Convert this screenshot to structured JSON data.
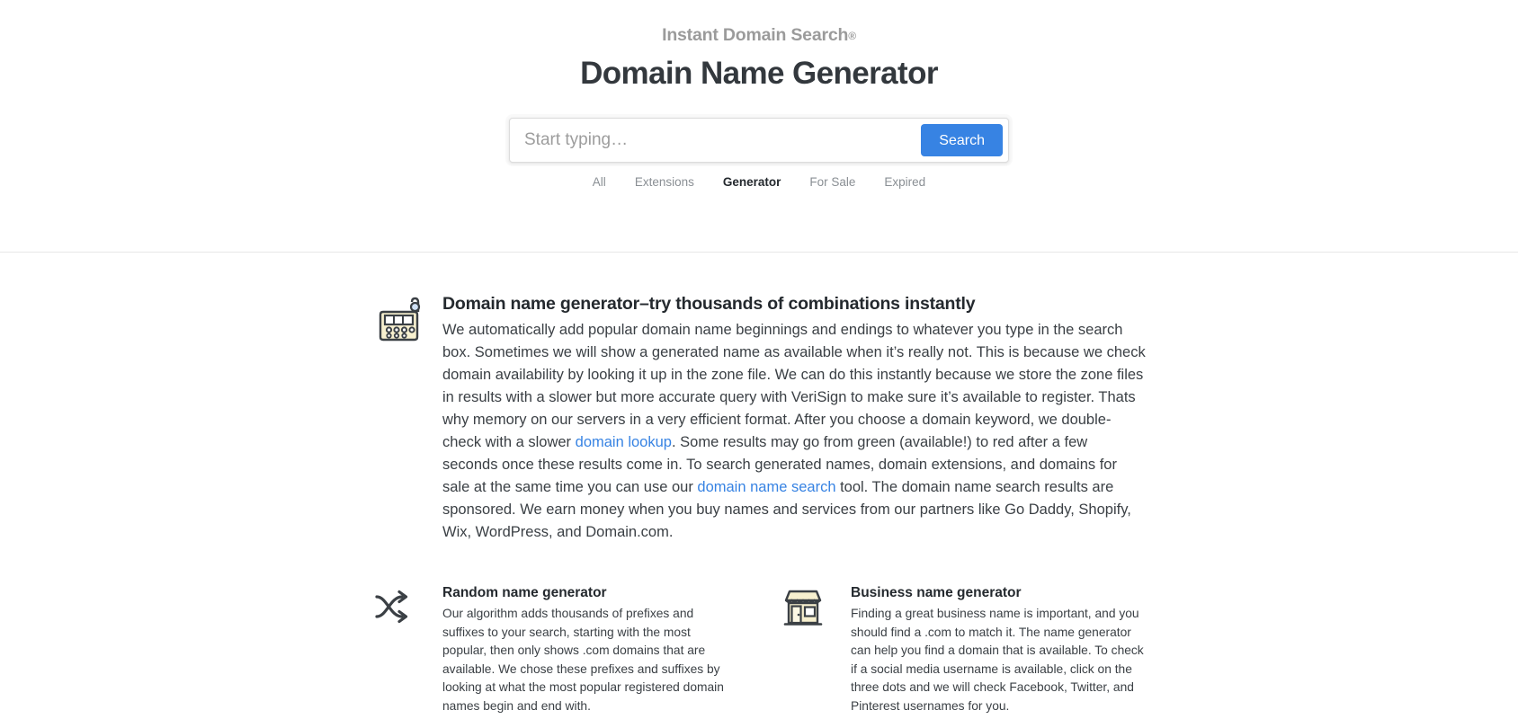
{
  "hero": {
    "brand": "Instant Domain Search",
    "brand_mark": "®",
    "title": "Domain Name Generator"
  },
  "search": {
    "placeholder": "Start typing…",
    "value": "",
    "button_label": "Search",
    "button_color": "#3783e3"
  },
  "tabs": [
    {
      "label": "All",
      "active": false
    },
    {
      "label": "Extensions",
      "active": false
    },
    {
      "label": "Generator",
      "active": true
    },
    {
      "label": "For Sale",
      "active": false
    },
    {
      "label": "Expired",
      "active": false
    }
  ],
  "lead": {
    "icon": "cash-register-icon",
    "title": "Domain name generator–try thousands of combinations instantly",
    "text_part_1": "We automatically add popular domain name beginnings and endings to whatever you type in the search box. Sometimes we will show a generated name as available when it’s really not. This is because we check domain availability by looking it up in the zone file. We can do this instantly because we store the zone files in results with a slower but more accurate query with VeriSign to make sure it’s available to register. Thats why memory on our servers in a very efficient format. After you choose a domain keyword, we double-check with a slower ",
    "link_1": "domain lookup",
    "text_part_2": ". Some results may go from green (available!) to red after a few seconds once these results come in. To search generated names, domain extensions, and domains for sale at the same time you can use our ",
    "link_2": "domain name search",
    "text_part_3": " tool. The domain name search results are sponsored. We earn money when you buy names and services from our partners like Go Daddy, Shopify, Wix, WordPress, and Domain.com."
  },
  "columns": [
    {
      "icon": "shuffle-icon",
      "title": "Random name generator",
      "text": "Our algorithm adds thousands of prefixes and suffixes to your search, starting with the most popular, then only shows .com domains that are available. We chose these prefixes and suffixes by looking at what the most popular registered domain names begin and end with."
    },
    {
      "icon": "storefront-icon",
      "title": "Business name generator",
      "text": "Finding a great business name is important, and you should find a .com to match it. The name generator can help you find a domain that is available. To check if a social media username is available, click on the three dots and we will check Facebook, Twitter, and Pinterest usernames for you."
    }
  ],
  "colors": {
    "accent": "#3783e3",
    "link": "#3783e3",
    "heading": "#24292e",
    "body": "#3b4045",
    "muted": "#8a8f94",
    "icon_fill": "#f7f0cf",
    "icon_stroke": "#3b4045"
  }
}
